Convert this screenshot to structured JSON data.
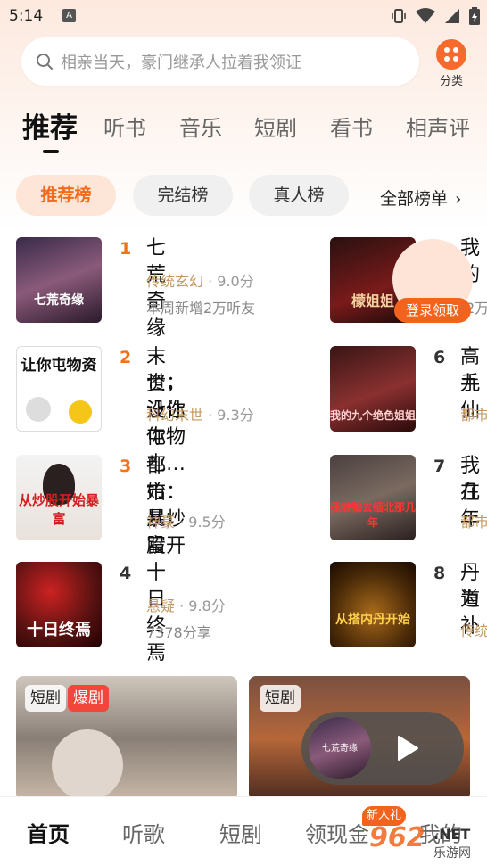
{
  "status_bar": {
    "time": "5:14",
    "notif_letter": "A"
  },
  "search": {
    "placeholder": "相亲当天，豪门继承人拉着我领证"
  },
  "category": {
    "label": "分类"
  },
  "tabs": [
    "推荐",
    "听书",
    "音乐",
    "短剧",
    "看书",
    "相声评"
  ],
  "chips": [
    "推荐榜",
    "完结榜",
    "真人榜"
  ],
  "all_rank": "全部榜单",
  "books_left": [
    {
      "rank": "1",
      "title": "七荒奇缘",
      "genre": "传统玄幻",
      "score": "9.0分",
      "sub": "本周新增2万听友",
      "cover_text": "七荒奇缘"
    },
    {
      "rank": "2",
      "title_line1": "末世：让你屯物",
      "title_line2": "资，没让你屯…",
      "genre": "科幻末世",
      "score": "9.3分",
      "cover_text": "让你屯物资"
    },
    {
      "rank": "3",
      "title_line1": "都市：从炒股开",
      "title_line2": "始暴富",
      "genre": "神豪",
      "score": "9.5分",
      "cover_text": "从炒股开始暴富"
    },
    {
      "rank": "4",
      "title": "十日终焉",
      "genre": "悬疑",
      "score": "9.8分",
      "sub": "7378分享",
      "cover_text": "十日终焉"
    }
  ],
  "books_right": [
    {
      "rank": "",
      "title": "我的",
      "genre": "",
      "sub": "2万",
      "cover_text": "檬姐姐"
    },
    {
      "rank": "6",
      "title_line1": "高手",
      "title_line2": "九仙",
      "genre": "都市",
      "cover_text": "我的九个绝色姐姐"
    },
    {
      "rank": "7",
      "title_line1": "我在",
      "title_line2": "几年",
      "genre": "都市",
      "cover_text": "我被骗去缅北那几年"
    },
    {
      "rank": "8",
      "title_line1": "丹道",
      "title_line2": "为补",
      "genre": "传统",
      "cover_text": "从搭内丹开始"
    }
  ],
  "login": {
    "label": "登录领取"
  },
  "dramas": [
    {
      "tag": "短剧",
      "tag2": "爆剧"
    },
    {
      "tag": "短剧"
    }
  ],
  "player": {
    "disc_text": "七荒奇缘"
  },
  "bottom_nav": [
    "首页",
    "听歌",
    "短剧",
    "领现金",
    "我的"
  ],
  "newbie_badge": "新人礼",
  "watermark": {
    "brand": "962",
    "suffix": ".NET",
    "site": "乐游网"
  },
  "colors": {
    "accent": "#f2641d",
    "genre": "#c49a62"
  }
}
